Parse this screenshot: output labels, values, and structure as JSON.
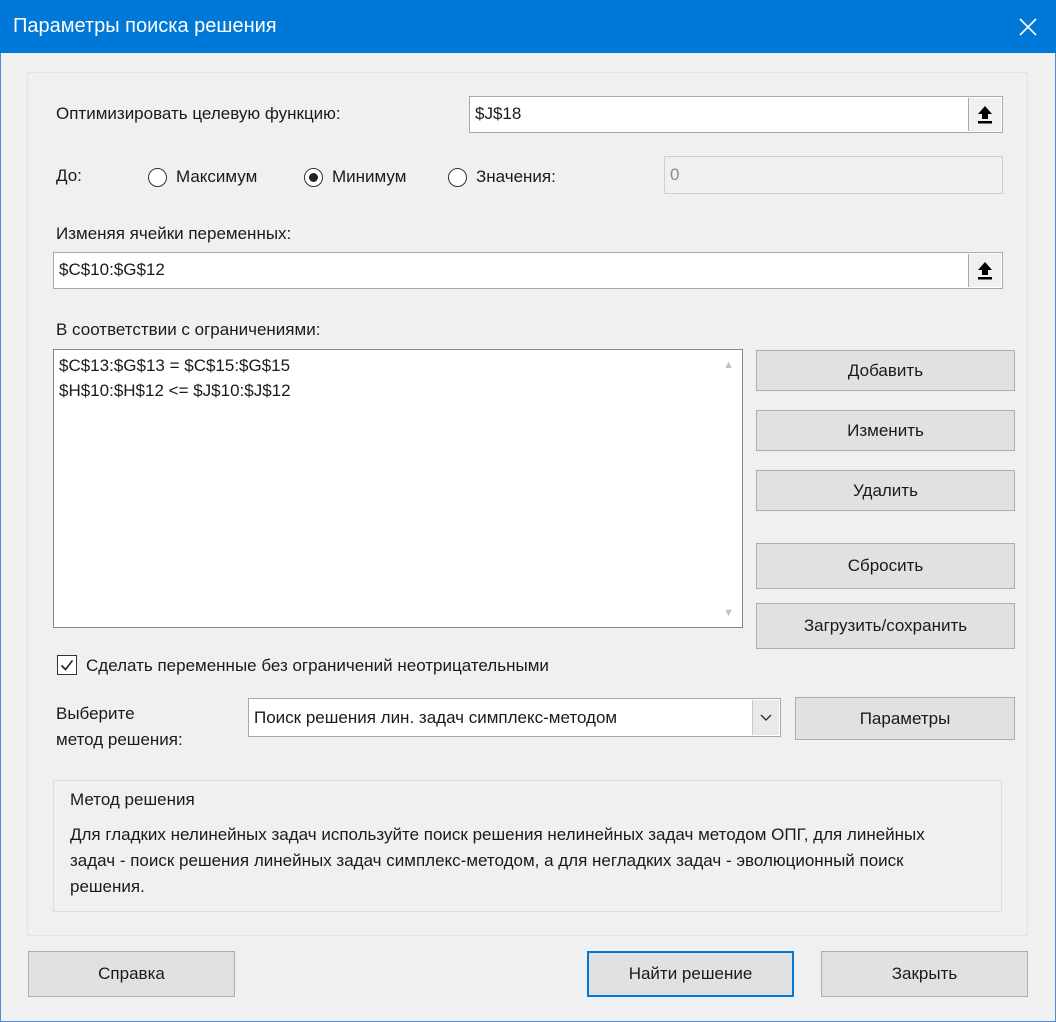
{
  "window": {
    "title": "Параметры поиска решения"
  },
  "objective": {
    "label": "Оптимизировать целевую функцию:",
    "value": "$J$18"
  },
  "to": {
    "label": "До:",
    "options": [
      {
        "label": "Максимум",
        "selected": false
      },
      {
        "label": "Минимум",
        "selected": true
      },
      {
        "label": "Значения:",
        "selected": false
      }
    ],
    "value_field": "0"
  },
  "variables": {
    "label": "Изменяя ячейки переменных:",
    "value": "$C$10:$G$12"
  },
  "constraints": {
    "label": "В соответствии с ограничениями:",
    "items": [
      "$C$13:$G$13 = $C$15:$G$15",
      "$H$10:$H$12 <= $J$10:$J$12"
    ]
  },
  "buttons": {
    "add": "Добавить",
    "change": "Изменить",
    "delete": "Удалить",
    "reset": "Сбросить",
    "load_save": "Загрузить/сохранить",
    "options": "Параметры",
    "help": "Справка",
    "solve": "Найти решение",
    "close": "Закрыть"
  },
  "nonnegative": {
    "label": "Сделать переменные без ограничений неотрицательными",
    "checked": true
  },
  "method": {
    "label_line1": "Выберите",
    "label_line2": "метод решения:",
    "selected": "Поиск решения лин. задач симплекс-методом"
  },
  "method_group": {
    "title": "Метод решения",
    "description": "Для гладких нелинейных задач используйте поиск решения нелинейных задач методом ОПГ, для линейных задач - поиск решения линейных задач симплекс-методом, а для негладких задач - эволюционный поиск решения."
  },
  "colors": {
    "titlebar": "#0078d7",
    "background": "#f0f0f0",
    "button": "#e1e1e1",
    "default_button_border": "#0078d7"
  }
}
